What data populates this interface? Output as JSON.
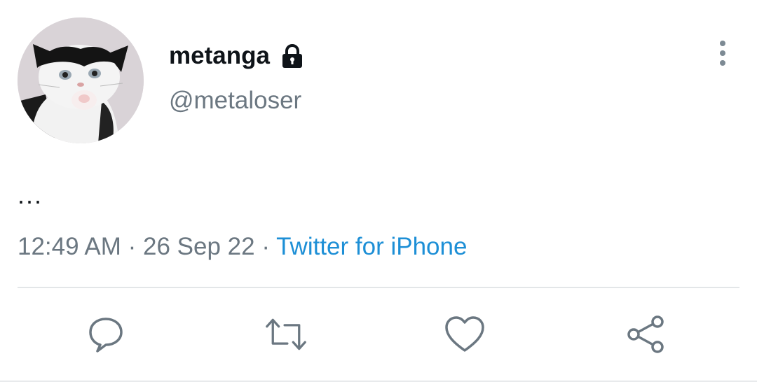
{
  "user": {
    "display_name": "metanga",
    "handle": "@metaloser",
    "protected": true,
    "avatar_icon": "cat-avatar"
  },
  "tweet": {
    "text": "...",
    "time": "12:49 AM",
    "separator": "·",
    "date": "26 Sep 22",
    "source": "Twitter for iPhone"
  },
  "actions": {
    "reply_icon": "reply-icon",
    "retweet_icon": "retweet-icon",
    "like_icon": "heart-icon",
    "share_icon": "share-icon"
  },
  "colors": {
    "text_primary": "#0f1419",
    "text_secondary": "#6b7781",
    "link": "#1d8fd6",
    "divider": "#e3e6e8"
  }
}
